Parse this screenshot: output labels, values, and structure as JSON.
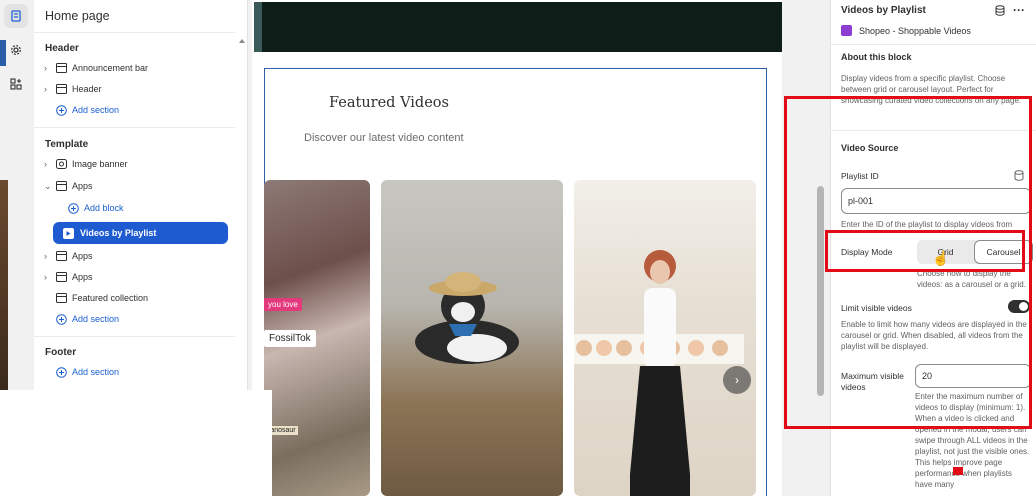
{
  "sidebar": {
    "title": "Home page",
    "sections": [
      {
        "heading": "Header",
        "items": [
          {
            "label": "Announcement bar",
            "icon": "layout-section-icon",
            "chevron": true
          },
          {
            "label": "Header",
            "icon": "layout-section-icon",
            "chevron": true
          },
          {
            "label": "Add section",
            "icon": "plus-circle-icon",
            "add": true
          }
        ]
      },
      {
        "heading": "Template",
        "items": [
          {
            "label": "Image banner",
            "icon": "image-icon",
            "chevron": true
          },
          {
            "label": "Apps",
            "icon": "layout-section-icon",
            "chevron": true,
            "expanded": true
          },
          {
            "label": "Add block",
            "icon": "plus-circle-icon",
            "add": true,
            "indent": true
          },
          {
            "label": "Videos by Playlist",
            "icon": "app-block-icon",
            "active": true
          },
          {
            "label": "Apps",
            "icon": "layout-section-icon",
            "chevron": true
          },
          {
            "label": "Apps",
            "icon": "layout-section-icon",
            "chevron": true
          },
          {
            "label": "Featured collection",
            "icon": "layout-section-icon",
            "chevron": false
          },
          {
            "label": "Add section",
            "icon": "plus-circle-icon",
            "add": true
          }
        ]
      },
      {
        "heading": "Footer",
        "items": [
          {
            "label": "Add section",
            "icon": "plus-circle-icon",
            "add": true
          }
        ]
      }
    ]
  },
  "preview": {
    "section_title": "Featured Videos",
    "section_subtitle": "Discover our latest video content",
    "card1_tag_top": "you love",
    "card1_tag_mid": "FossilTok",
    "card1_tag_bottom": "ranosaur",
    "next_icon": "chevron-right-icon"
  },
  "panel": {
    "title": "Videos by Playlist",
    "app_name": "Shopeo - Shoppable Videos",
    "about_heading": "About this block",
    "about_text": "Display videos from a specific playlist. Choose between grid or carousel layout. Perfect for showcasing curated video collections on any page.",
    "source_heading": "Video Source",
    "playlist_label": "Playlist ID",
    "playlist_value": "pl-001",
    "playlist_help": "Enter the ID of the playlist to display videos from",
    "display_mode_label": "Display Mode",
    "display_mode_options": [
      "Grid",
      "Carousel"
    ],
    "display_mode_selected": "Carousel",
    "display_mode_help": "Choose how to display the videos: as a carousel or a grid.",
    "limit_label": "Limit visible videos",
    "limit_enabled": true,
    "limit_help": "Enable to limit how many videos are displayed in the carousel or grid. When disabled, all videos from the playlist will be displayed.",
    "max_label": "Maximum visible videos",
    "max_value": "20",
    "max_help": "Enter the maximum number of videos to display (minimum: 1). When a video is clicked and opened in the modal, users can swipe through ALL videos in the playlist, not just the visible ones. This helps improve page performance when playlists have many"
  },
  "colors": {
    "accent": "#1f5bd0",
    "annotation": "#e30b17",
    "app_icon": "#8c3fd1"
  }
}
